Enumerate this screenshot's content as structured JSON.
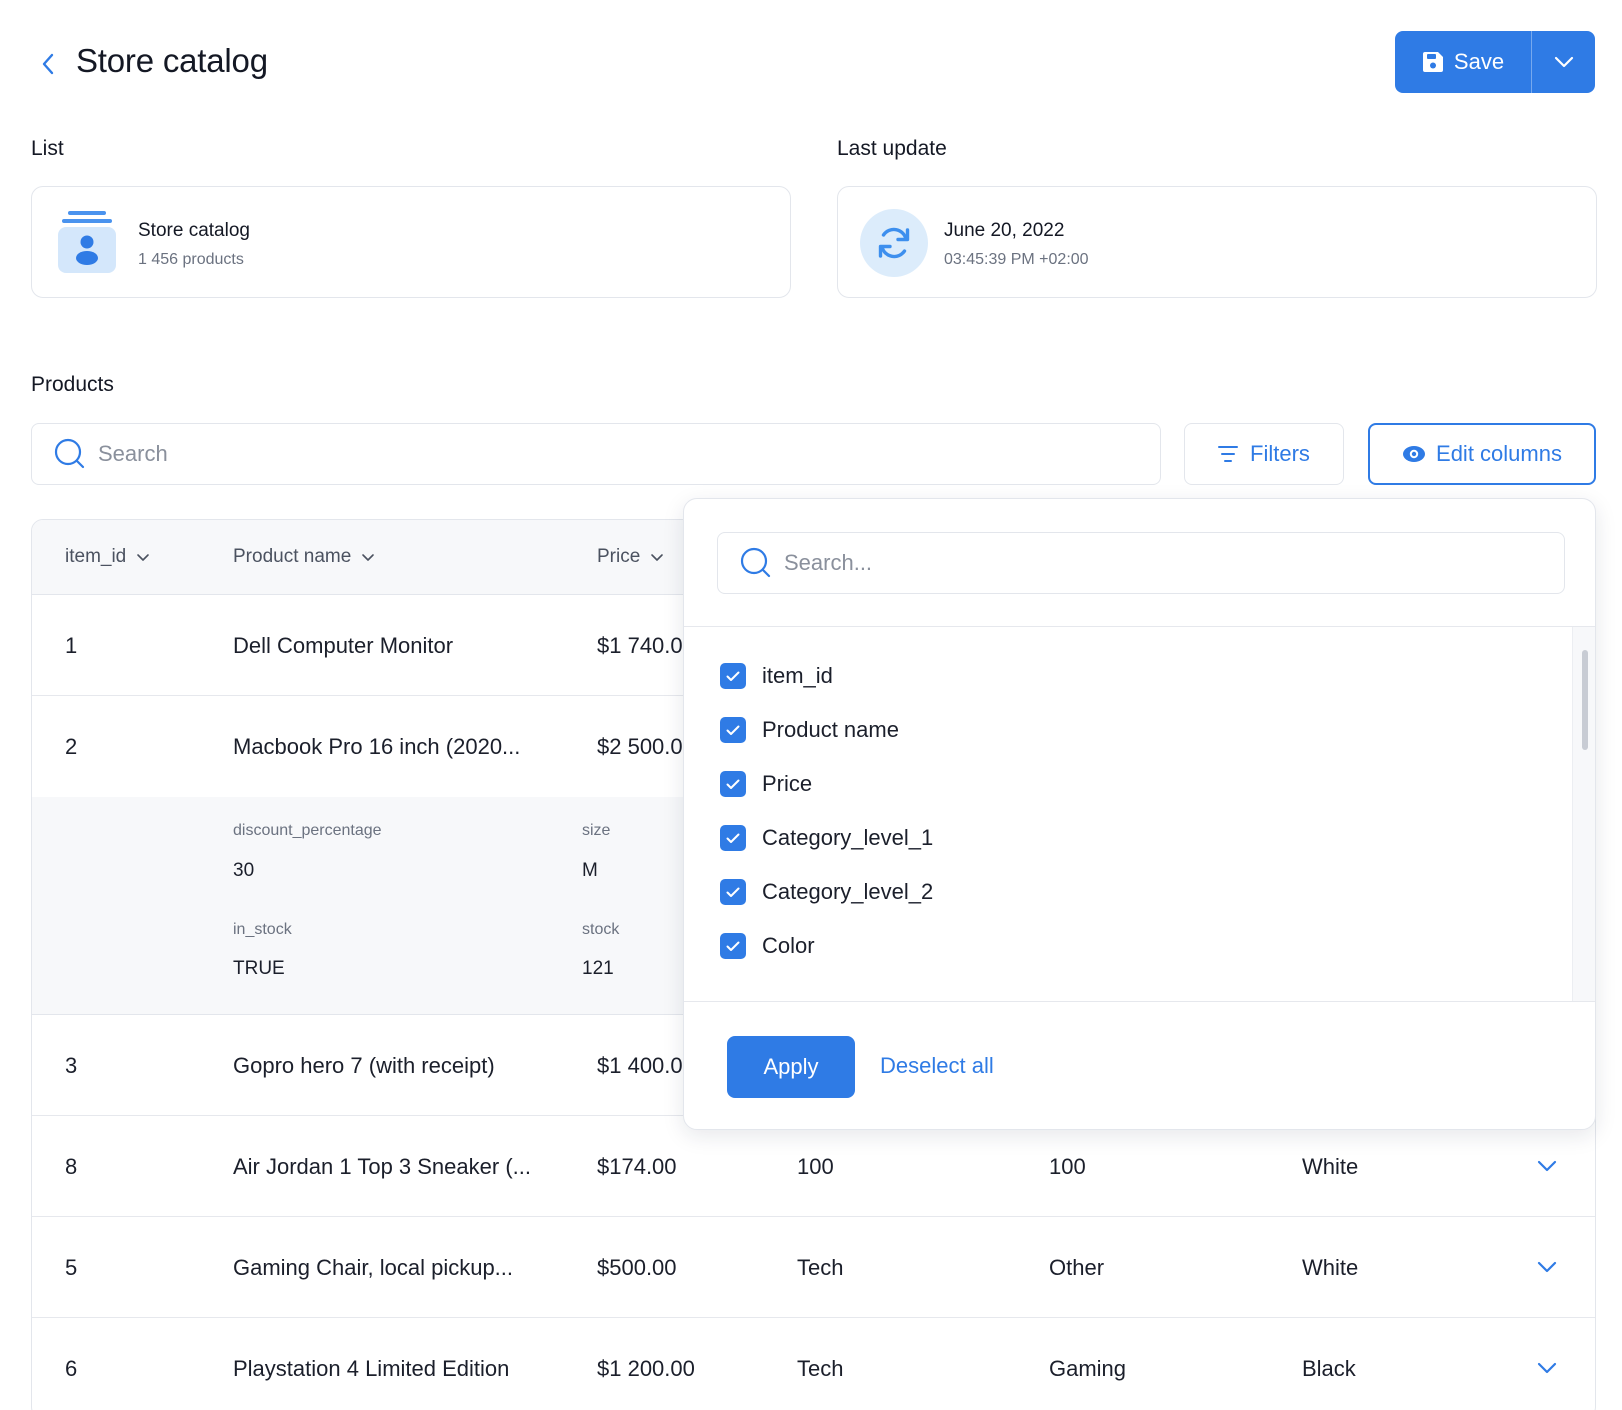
{
  "header": {
    "title": "Store catalog",
    "save_label": "Save"
  },
  "sections": {
    "list_label": "List",
    "last_update_label": "Last update",
    "products_label": "Products"
  },
  "list_card": {
    "title": "Store catalog",
    "subtitle": "1 456 products"
  },
  "update_card": {
    "date": "June 20, 2022",
    "time": "03:45:39 PM +02:00"
  },
  "toolbar": {
    "search_placeholder": "Search",
    "filters_label": "Filters",
    "edit_columns_label": "Edit columns"
  },
  "table": {
    "headers": [
      "item_id",
      "Product name",
      "Price"
    ],
    "rows": [
      {
        "id": "1",
        "name": "Dell Computer Monitor",
        "price": "$1 740.00",
        "cat1": "",
        "cat2": "",
        "color": ""
      },
      {
        "id": "2",
        "name": "Macbook Pro 16 inch (2020...",
        "price": "$2 500.00",
        "cat1": "",
        "cat2": "",
        "color": ""
      },
      {
        "id": "3",
        "name": "Gopro hero 7 (with receipt)",
        "price": "$1 400.00",
        "cat1": "",
        "cat2": "",
        "color": ""
      },
      {
        "id": "8",
        "name": "Air Jordan 1 Top 3 Sneaker (...",
        "price": "$174.00",
        "cat1": "100",
        "cat2": "100",
        "color": "White"
      },
      {
        "id": "5",
        "name": "Gaming Chair, local pickup...",
        "price": "$500.00",
        "cat1": "Tech",
        "cat2": "Other",
        "color": "White"
      },
      {
        "id": "6",
        "name": "Playstation 4 Limited Edition",
        "price": "$1 200.00",
        "cat1": "Tech",
        "cat2": "Gaming",
        "color": "Black"
      }
    ],
    "expanded_details": {
      "discount_label": "discount_percentage",
      "discount_value": "30",
      "size_label": "size",
      "size_value": "M",
      "in_stock_label": "in_stock",
      "in_stock_value": "TRUE",
      "stock_label": "stock",
      "stock_value": "121"
    }
  },
  "edit_columns": {
    "search_placeholder": "Search...",
    "columns": [
      {
        "label": "item_id",
        "checked": true
      },
      {
        "label": "Product name",
        "checked": true
      },
      {
        "label": "Price",
        "checked": true
      },
      {
        "label": "Category_level_1",
        "checked": true
      },
      {
        "label": "Category_level_2",
        "checked": true
      },
      {
        "label": "Color",
        "checked": true
      }
    ],
    "apply_label": "Apply",
    "deselect_label": "Deselect all"
  },
  "colors": {
    "accent": "#2f7be5",
    "icon_bg": "#dcecfb",
    "border": "#e3e6ec"
  }
}
